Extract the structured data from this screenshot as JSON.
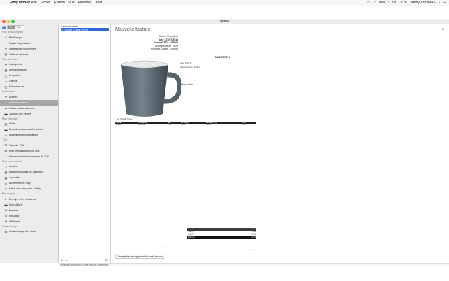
{
  "menubar": {
    "app_name": "Fidly Money Pro",
    "items": [
      "Fichier",
      "Edition",
      "Vue",
      "Fenêtres",
      "Aide"
    ],
    "datetime": "Mer. 27 juil. 12:26",
    "user": "Jimmy THOMAS"
  },
  "window": {
    "title": "demo"
  },
  "sidebar": {
    "toggle": [
      "Cré",
      "Dér"
    ],
    "sections": [
      {
        "title": "Voir mes comptes",
        "items": [
          {
            "icon": "euro-icon",
            "glyph": "€",
            "label": "Ma Banque"
          },
          {
            "icon": "plus-icon",
            "glyph": "✚",
            "label": "Saisie d'opérations"
          },
          {
            "icon": "recurring-icon",
            "glyph": "⟳",
            "label": "Opérations récurrentes"
          },
          {
            "icon": "dashboard-icon",
            "glyph": "▤",
            "label": "Tableau de bord"
          }
        ]
      },
      {
        "title": "Mes données",
        "items": [
          {
            "icon": "tag-icon",
            "glyph": "⚑",
            "label": "Catégories"
          },
          {
            "icon": "building-icon",
            "glyph": "▦",
            "label": "Immobilisations"
          },
          {
            "icon": "loan-icon",
            "glyph": "◫",
            "label": "Emprunts"
          },
          {
            "icon": "clients-icon",
            "glyph": "●",
            "label": "Clients"
          },
          {
            "icon": "supplier-icon",
            "glyph": "◰",
            "label": "Fournisseurs"
          }
        ]
      },
      {
        "title": "Facturation",
        "items": [
          {
            "icon": "article-icon",
            "glyph": "⚑",
            "label": "Articles"
          },
          {
            "icon": "client-invoice-icon",
            "glyph": "♟",
            "label": "Factures clients",
            "selected": true
          },
          {
            "icon": "supplier-invoice-icon",
            "glyph": "♟",
            "label": "Factures fournisseurs"
          },
          {
            "icon": "sales-journal-icon",
            "glyph": "▬",
            "label": "Journal des ventes"
          }
        ]
      },
      {
        "title": "Mes résultats",
        "items": [
          {
            "icon": "stats-icon",
            "glyph": "▤",
            "label": "Stats"
          },
          {
            "icon": "ledger-icon",
            "glyph": "▬",
            "label": "Livre des dépenses/recettes"
          },
          {
            "icon": "assets-list-icon",
            "glyph": "▬",
            "label": "Liste des immobilisations"
          }
        ]
      },
      {
        "title": "TVA",
        "items": [
          {
            "icon": "vat-rate-icon",
            "glyph": "%",
            "label": "Taux de TVA"
          },
          {
            "icon": "vat-state-icon",
            "glyph": "▤",
            "label": "Etat préparatoire à la TVA"
          },
          {
            "icon": "vat-payment-icon",
            "glyph": "♟",
            "label": "Paiement/remboursement de TVA"
          }
        ]
      },
      {
        "title": "Mes informations",
        "items": [
          {
            "icon": "company-icon",
            "glyph": "⌂",
            "label": "Société"
          },
          {
            "icon": "bank-icon",
            "glyph": "▦",
            "label": "Banques/Modes de paiement"
          },
          {
            "icon": "partners-icon",
            "glyph": "▦",
            "label": "Associés"
          },
          {
            "icon": "subscription-icon",
            "glyph": "▭",
            "label": "Abonnement Fidly"
          },
          {
            "icon": "request-icon",
            "glyph": "✎",
            "label": "Faire une demande à Fidly"
          }
        ]
      },
      {
        "title": "Ma compta",
        "items": [
          {
            "icon": "send-icon",
            "glyph": "➤",
            "label": "Envoyer mes écritures"
          },
          {
            "icon": "grand-livre-icon",
            "glyph": "▬",
            "label": "Grand-livre"
          },
          {
            "icon": "balance-icon",
            "glyph": "⚖",
            "label": "Balance"
          },
          {
            "icon": "result-icon",
            "glyph": "▭",
            "label": "Résultat"
          },
          {
            "icon": "utilities-icon",
            "glyph": "⚙",
            "label": "Utilitaires"
          }
        ]
      },
      {
        "title": "Paramétrage",
        "items": [
          {
            "icon": "settings-icon",
            "glyph": "▤",
            "label": "Paramétrage des états"
          }
        ]
      }
    ]
  },
  "list": {
    "header": "Factures clients",
    "items": [
      {
        "label": "Facture 1 (Mon client)"
      }
    ],
    "add": "+",
    "remove": "—"
  },
  "main": {
    "title": "Nouvelle facture",
    "summary": [
      {
        "label": "Client :",
        "value": "Mon client",
        "bold": false
      },
      {
        "label": "Date :",
        "value": "27/07/2016",
        "bold": true
      },
      {
        "label": "Montant TTC :",
        "value": "178,08",
        "bold": true
      },
      {
        "label": "Acompte versé :",
        "value": "0,00",
        "bold": false
      },
      {
        "label": "Montant à payer :",
        "value": "178,08",
        "bold": false
      }
    ],
    "invoice": {
      "title": "FACTURE 1",
      "meta": [
        "Date : 27/07/16",
        "Date d'échéance : 27/08/16"
      ],
      "client": "Mon client",
      "table_caption": "Voir 'Nouvelle facture'",
      "columns": [
        "Article",
        "Description",
        "Qté",
        "PU HT (€)",
        "Montant HT (€)",
        "TVA"
      ],
      "rows": [
        [
          "Produit 1",
          "Ma tasse",
          "1,00",
          "99,80",
          "148,40",
          "20 %"
        ]
      ],
      "totals": [
        {
          "label": "Total HT",
          "value": "148,40",
          "style": "dark"
        },
        {
          "label": "TVA 20 %",
          "value": "29,68",
          "style": ""
        },
        {
          "label": "Total TTC",
          "value": "178,08",
          "style": ""
        },
        {
          "label": "A REGLER",
          "value": "178,08",
          "style": "black"
        }
      ],
      "footnote": "Pénalités",
      "page": "Page 1 sur 1"
    },
    "register_button": "Enregistrer le règlement de cette facture"
  },
  "status": "Mode administration. Cette version est limitée."
}
